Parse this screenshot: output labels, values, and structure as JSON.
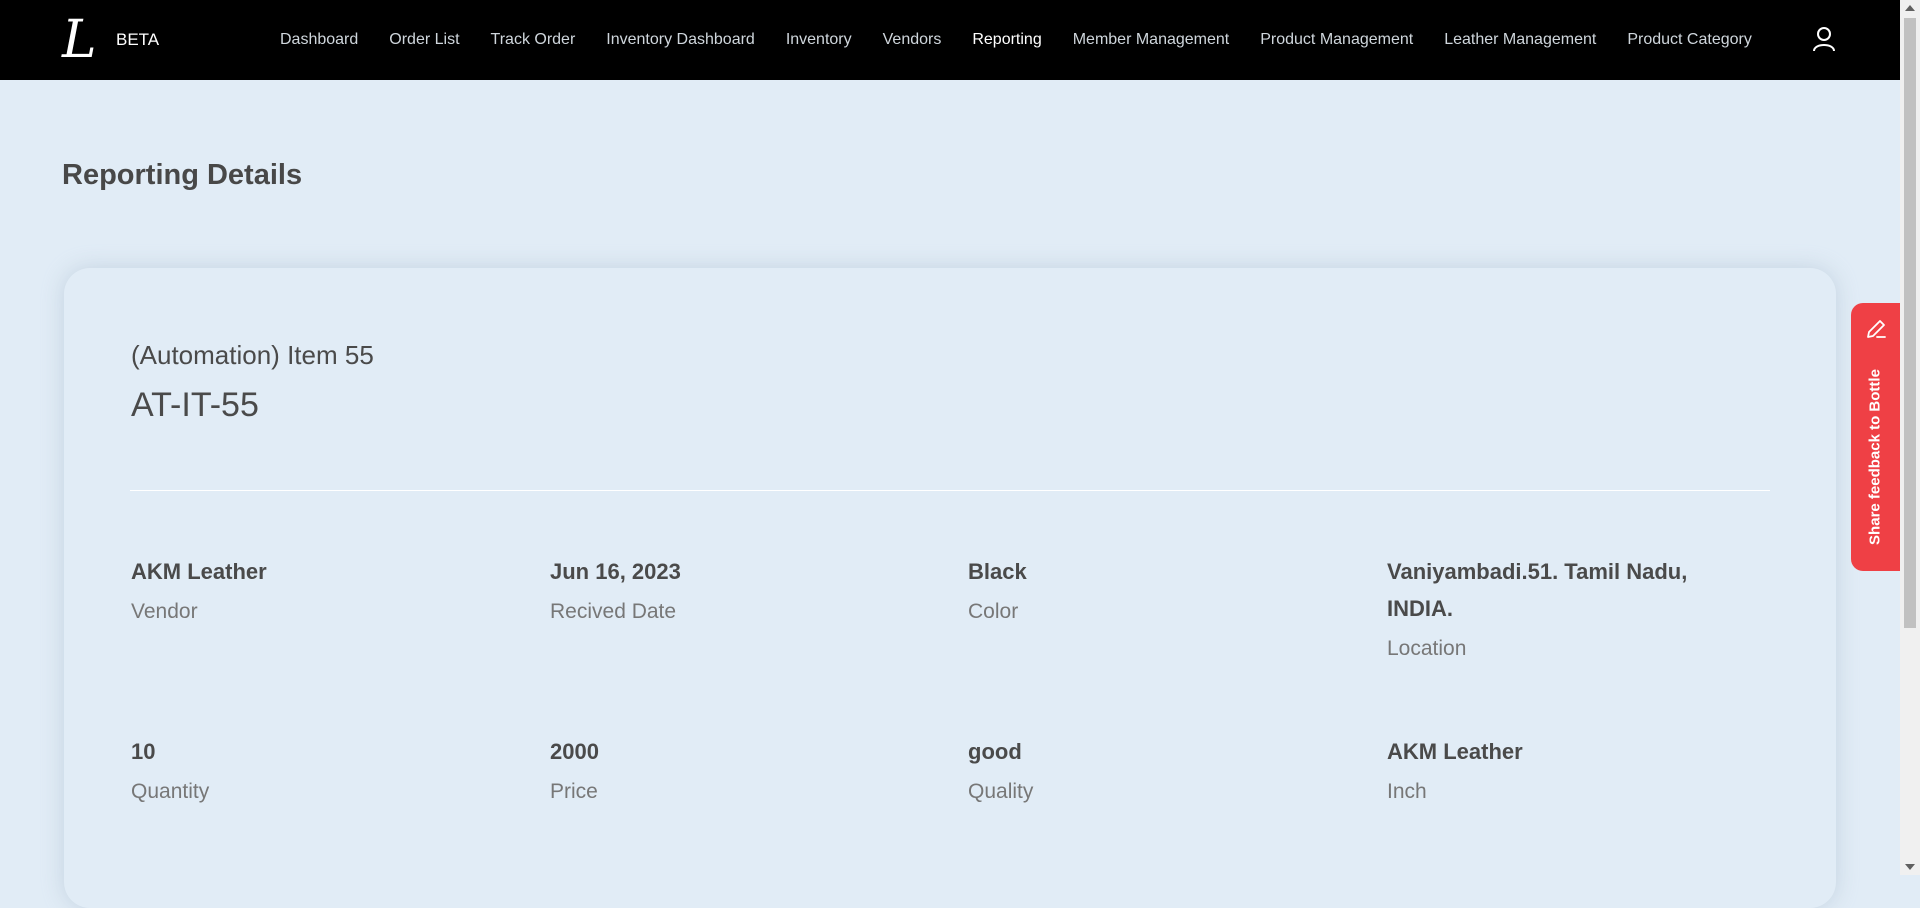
{
  "header": {
    "logo": "L",
    "beta_label": "BETA",
    "nav": [
      {
        "label": "Dashboard",
        "active": false
      },
      {
        "label": "Order List",
        "active": false
      },
      {
        "label": "Track Order",
        "active": false
      },
      {
        "label": "Inventory Dashboard",
        "active": false
      },
      {
        "label": "Inventory",
        "active": false
      },
      {
        "label": "Vendors",
        "active": false
      },
      {
        "label": "Reporting",
        "active": true
      },
      {
        "label": "Member Management",
        "active": false
      },
      {
        "label": "Product Management",
        "active": false
      },
      {
        "label": "Leather Management",
        "active": false
      },
      {
        "label": "Product Category",
        "active": false
      }
    ],
    "user_icon": "user-icon"
  },
  "page": {
    "title": "Reporting Details"
  },
  "card": {
    "item_name": "(Automation) Item 55",
    "item_code": "AT-IT-55",
    "fields": [
      {
        "value": "AKM Leather",
        "label": "Vendor"
      },
      {
        "value": "Jun 16, 2023",
        "label": "Recived Date"
      },
      {
        "value": "Black",
        "label": "Color"
      },
      {
        "value": "Vaniyambadi.51. Tamil Nadu, INDIA.",
        "label": "Location"
      },
      {
        "value": "10",
        "label": "Quantity"
      },
      {
        "value": "2000",
        "label": "Price"
      },
      {
        "value": "good",
        "label": "Quality"
      },
      {
        "value": "AKM Leather",
        "label": "Inch"
      }
    ]
  },
  "feedback": {
    "label": "Share feedback to Bottle",
    "icon": "pencil-icon"
  },
  "colors": {
    "header_bg": "#000000",
    "page_bg": "#e1ecf6",
    "feedback_bg": "#ef4045"
  }
}
